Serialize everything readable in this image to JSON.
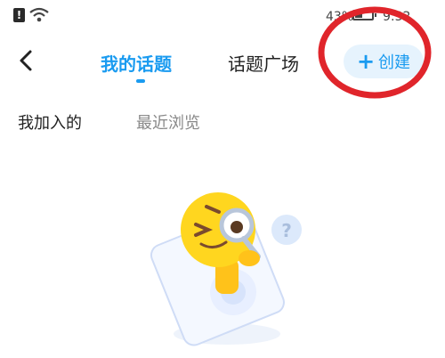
{
  "status_bar": {
    "alert_glyph": "!",
    "battery_percent": "43%",
    "battery_level": 0.43,
    "time": "9:32",
    "icons": [
      "alert-icon",
      "wifi-icon",
      "battery-icon"
    ]
  },
  "nav": {
    "back_icon": "back-chevron-icon",
    "tabs": [
      {
        "label": "我的话题",
        "selected": true
      },
      {
        "label": "话题广场",
        "selected": false
      }
    ],
    "create_button": {
      "plus": "+",
      "label": "创建"
    }
  },
  "sub_tabs": [
    {
      "label": "我加入的",
      "selected": true
    },
    {
      "label": "最近浏览",
      "selected": false
    }
  ],
  "empty_state": {
    "illustration": "emoji-magnifier-illustration",
    "bubble_glyph": "?"
  },
  "colors": {
    "accent": "#1a9bf0",
    "create_bg": "#e6f3fd",
    "annotation": "#e0252b",
    "emoji": "#ffd61f"
  }
}
